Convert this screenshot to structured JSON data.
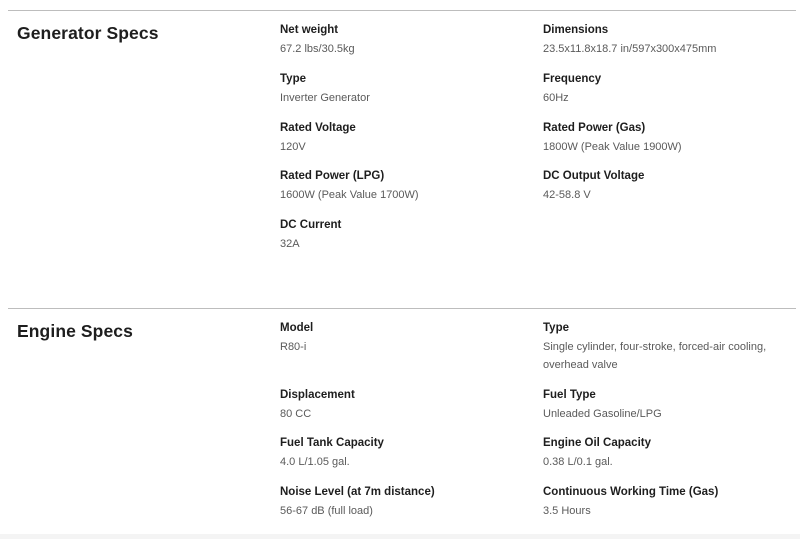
{
  "generator": {
    "title": "Generator Specs",
    "specs": [
      {
        "label": "Net weight",
        "value": "67.2 lbs/30.5kg"
      },
      {
        "label": "Dimensions",
        "value": "23.5x11.8x18.7 in/597x300x475mm"
      },
      {
        "label": "Type",
        "value": "Inverter Generator"
      },
      {
        "label": "Frequency",
        "value": "60Hz"
      },
      {
        "label": "Rated Voltage",
        "value": "120V"
      },
      {
        "label": "Rated Power (Gas)",
        "value": "1800W (Peak Value 1900W)"
      },
      {
        "label": "Rated Power (LPG)",
        "value": "1600W (Peak Value 1700W)"
      },
      {
        "label": "DC Output Voltage",
        "value": "42-58.8 V"
      },
      {
        "label": "DC Current",
        "value": "32A"
      }
    ]
  },
  "engine": {
    "title": "Engine Specs",
    "specs": [
      {
        "label": "Model",
        "value": "R80-i"
      },
      {
        "label": "Type",
        "value": "Single cylinder, four-stroke, forced-air cooling, overhead valve"
      },
      {
        "label": "Displacement",
        "value": "80 CC"
      },
      {
        "label": "Fuel Type",
        "value": "Unleaded Gasoline/LPG"
      },
      {
        "label": "Fuel Tank Capacity",
        "value": "4.0 L/1.05 gal."
      },
      {
        "label": "Engine Oil Capacity",
        "value": "0.38 L/0.1 gal."
      },
      {
        "label": "Noise Level (at 7m distance)",
        "value": "56-67 dB (full load)"
      },
      {
        "label": "Continuous Working Time (Gas)",
        "value": "3.5 Hours"
      }
    ]
  }
}
